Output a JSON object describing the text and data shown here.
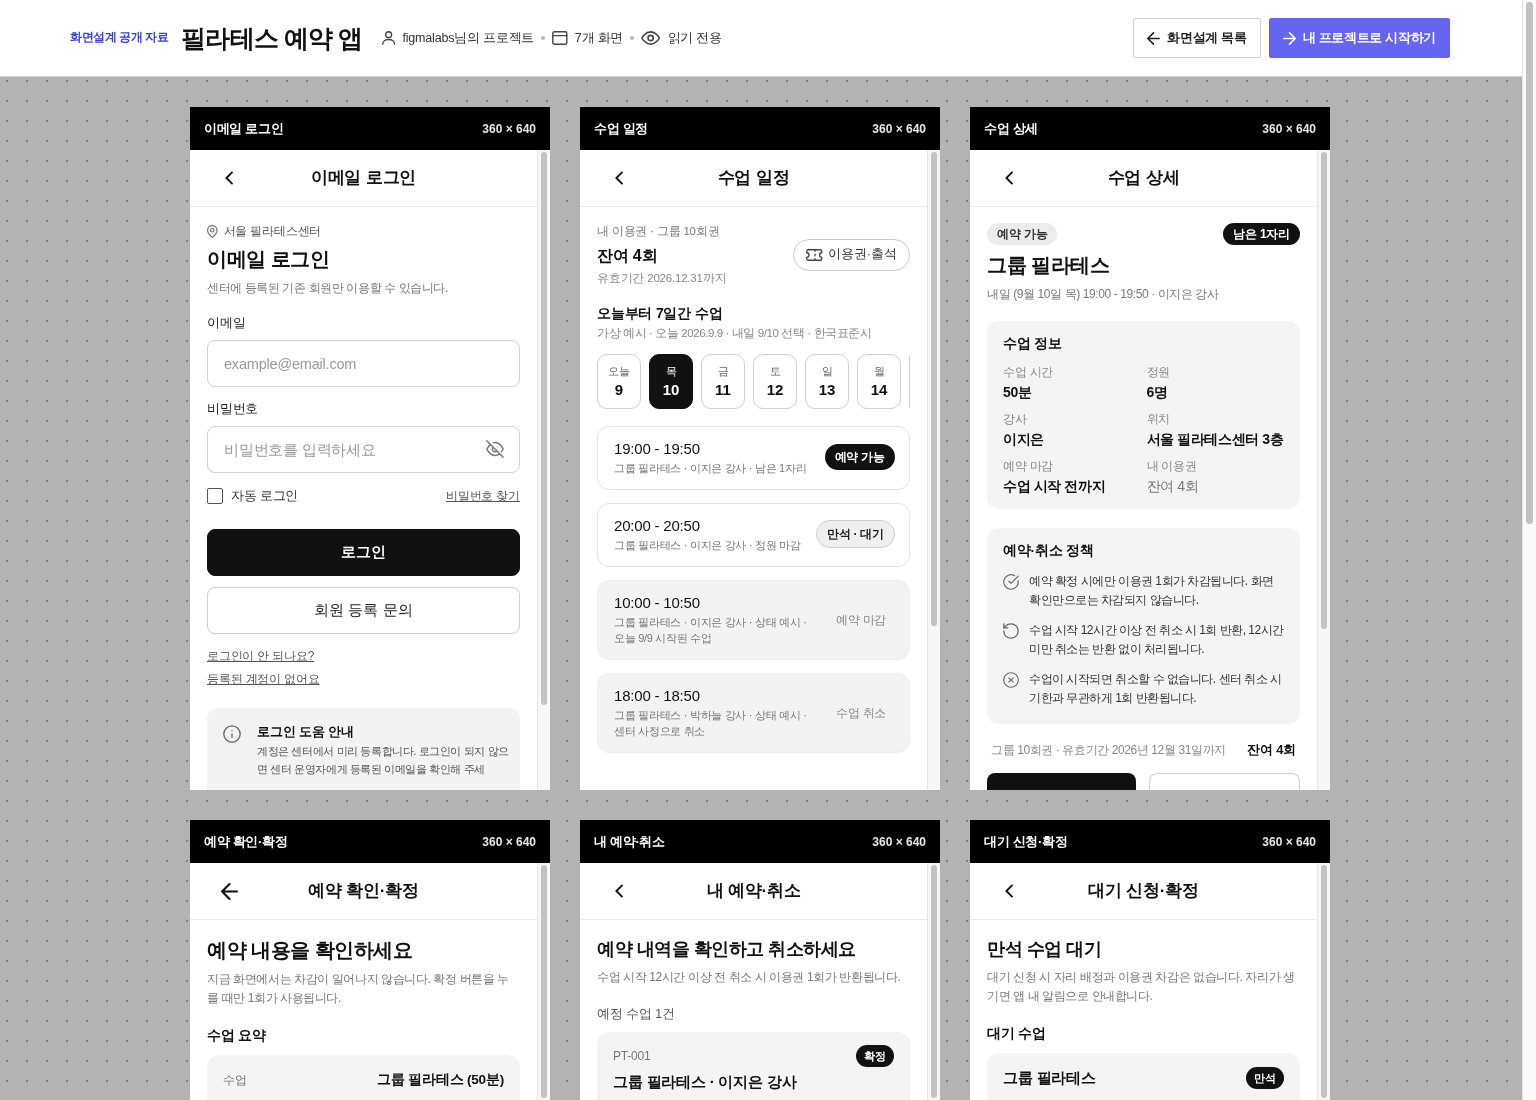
{
  "header": {
    "eyebrow": "화면설계 공개 자료",
    "title": "필라테스 예약 앱",
    "meta": [
      {
        "kind": "owner",
        "text": "figmalabs님의 프로젝트"
      },
      {
        "kind": "screens",
        "text": "7개 화면"
      },
      {
        "kind": "access",
        "text": "읽기 전용"
      }
    ],
    "buttons": [
      {
        "kind": "back",
        "label": "화면설계 목록"
      },
      {
        "kind": "start",
        "label": "내 프로젝트로 시작하기"
      }
    ]
  },
  "screens": [
    {
      "frame_title": "이메일 로그인",
      "size": "360 × 640",
      "back_button": {
        "kind": "chevron"
      },
      "title": "이메일 로그인",
      "blocks": [
        {
          "kind": "location",
          "text": "서울 필라테스센터"
        },
        {
          "kind": "heading",
          "text": "이메일 로그인"
        },
        {
          "kind": "subtitle",
          "text": "센터에 등록된 기존 회원만 이용할 수 있습니다."
        },
        {
          "kind": "email_field",
          "label": "이메일",
          "placeholder": "example@email.com"
        },
        {
          "kind": "password_field",
          "label": "비밀번호",
          "placeholder": "비밀번호를 입력하세요"
        },
        {
          "kind": "remember_row",
          "label": "자동 로그인",
          "checked": false,
          "link": "비밀번호 찾기"
        },
        {
          "kind": "primary_button",
          "label": "로그인"
        },
        {
          "kind": "outline_button",
          "label": "회원 등록 문의"
        },
        {
          "kind": "links",
          "items": [
            "로그인이 안 되나요?",
            "등록된 계정이 없어요"
          ]
        },
        {
          "kind": "help",
          "title": "로그인 도움 안내",
          "text": "계정은 센터에서 미리 등록합니다. 로그인이 되지 않으면 센터 운영자에게 등록된 이메일을 확인해 주세"
        }
      ]
    },
    {
      "frame_title": "수업 일정",
      "size": "360 × 640",
      "back_button": {
        "kind": "chevron"
      },
      "title": "수업 일정",
      "blocks": [
        {
          "kind": "pass_header",
          "label": "내 이용권 · 그룹 10회권",
          "remaining": "잔여 **4**회",
          "validity": "유효기간 2026.12.31까지",
          "button": "이용권·출석"
        },
        {
          "kind": "section",
          "title": "오늘부터 7일간 수업",
          "note": "가상 예시 · 오늘 2026.9.9 · 내일 9/10 선택 · 한국표준시",
          "muted": false
        },
        {
          "kind": "date_row",
          "dates": [
            {
              "day": "오늘",
              "date": "9",
              "selected": false
            },
            {
              "day": "목",
              "date": "10",
              "selected": true
            },
            {
              "day": "금",
              "date": "11",
              "selected": false
            },
            {
              "day": "토",
              "date": "12",
              "selected": false
            },
            {
              "day": "일",
              "date": "13",
              "selected": false
            },
            {
              "day": "월",
              "date": "14",
              "selected": false
            }
          ]
        },
        {
          "kind": "class_card",
          "time": "19:00 - 19:50",
          "meta": "그룹 필라테스 · 이지은 강사 · 남은 1자리",
          "status": {
            "kind": "available",
            "label": "예약 가능"
          }
        },
        {
          "kind": "class_card",
          "time": "20:00 - 20:50",
          "meta": "그룹 필라테스 · 이지은 강사 · 정원 마감",
          "status": {
            "kind": "waitlist",
            "label": "만석 · 대기"
          }
        },
        {
          "kind": "class_card",
          "time": "10:00 - 10:50",
          "meta": "그룹 필라테스 · 이지은 강사 · 상태 예시 · 오늘 9/9 시작된 수업",
          "status": {
            "kind": "closed",
            "label": "예약 마감"
          }
        },
        {
          "kind": "class_card",
          "time": "18:00 - 18:50",
          "meta": "그룹 필라테스 · 박하늘 강사 · 상태 예시 · 센터 사정으로 취소",
          "status": {
            "kind": "cancelled",
            "label": "수업 취소"
          }
        }
      ]
    },
    {
      "frame_title": "수업 상세",
      "size": "360 × 640",
      "back_button": {
        "kind": "chevron"
      },
      "title": "수업 상세",
      "blocks": [
        {
          "kind": "badge_row",
          "badges": [
            {
              "kind": "status",
              "text": "예약 가능"
            },
            {
              "kind": "seats",
              "text": "남은 1자리"
            }
          ]
        },
        {
          "kind": "heading",
          "text": "그룹 필라테스"
        },
        {
          "kind": "subtitle",
          "text": "내일 (9월 10일 목) 19:00 - 19:50 · 이지은 강사"
        },
        {
          "kind": "info_card",
          "title": "수업 정보",
          "items": [
            {
              "label": "수업 시간",
              "value": "50분",
              "muted": false
            },
            {
              "label": "정원",
              "value": "6명",
              "muted": false
            },
            {
              "label": "강사",
              "value": "이지은",
              "muted": false
            },
            {
              "label": "위치",
              "value": "서울 필라테스센터 3층",
              "muted": false
            },
            {
              "label": "예약 마감",
              "value": "수업 시작 전까지",
              "muted": false
            },
            {
              "label": "내 이용권",
              "value": "잔여 4회",
              "muted": true
            }
          ]
        },
        {
          "kind": "policy_card",
          "title": "예약·취소 정책",
          "items": [
            {
              "kind": "check",
              "text": "예약 확정 시에만 이용권 1회가 차감됩니다. 화면 확인만으로는 차감되지 않습니다."
            },
            {
              "kind": "refund",
              "text": "수업 시작 12시간 이상 전 취소 시 1회 반환, 12시간 미만 취소는 반환 없이 처리됩니다."
            },
            {
              "kind": "cancel",
              "text": "수업이 시작되면 취소할 수 없습니다. 센터 취소 시 기한과 무관하게 1회 반환됩니다."
            }
          ]
        },
        {
          "kind": "pass_footer",
          "text": "그룹 10회권 · 유효기간 2026년 12월 31일까지",
          "value": "잔여 4회"
        },
        {
          "kind": "action_row",
          "buttons": [
            {
              "kind": "primary"
            },
            {
              "kind": "secondary"
            }
          ]
        }
      ]
    },
    {
      "frame_title": "예약 확인·확정",
      "size": "360 × 640",
      "back_button": {
        "kind": "arrow"
      },
      "title": "예약 확인·확정",
      "blocks": [
        {
          "kind": "heading",
          "text": "예약 내용을 확인하세요"
        },
        {
          "kind": "subtitle",
          "text": "지금 화면에서는 차감이 일어나지 않습니다. 확정 버튼을 누를 때만 1회가 사용됩니다."
        },
        {
          "kind": "section",
          "title": "수업 요약",
          "muted": false
        },
        {
          "kind": "summary_card",
          "rows": [
            {
              "label": "수업",
              "value": "그룹 필라테스 (50분)"
            }
          ]
        }
      ]
    },
    {
      "frame_title": "내 예약·취소",
      "size": "360 × 640",
      "back_button": {
        "kind": "chevron"
      },
      "title": "내 예약·취소",
      "blocks": [
        {
          "kind": "heading_compact",
          "text": "예약 내역을 확인하고 취소하세요"
        },
        {
          "kind": "subtitle",
          "text": "수업 시작 12시간 이상 전 취소 시 이용권 1회가 반환됩니다."
        },
        {
          "kind": "section",
          "title": "예정 수업 1건",
          "muted": true
        },
        {
          "kind": "booking_card",
          "code": "PT-001",
          "badge": "확정",
          "title": "그룹 필라테스 · 이지은 강사"
        }
      ]
    },
    {
      "frame_title": "대기 신청·확정",
      "size": "360 × 640",
      "back_button": {
        "kind": "chevron"
      },
      "title": "대기 신청·확정",
      "blocks": [
        {
          "kind": "heading_compact",
          "text": "만석 수업 대기"
        },
        {
          "kind": "subtitle",
          "text": "대기 신청 시 자리 배정과 이용권 차감은 없습니다. 자리가 생기면 앱 내 알림으로 안내합니다."
        },
        {
          "kind": "section",
          "title": "대기 수업",
          "muted": false
        },
        {
          "kind": "waitlist_card",
          "title": "그룹 필라테스",
          "badge": "만석"
        }
      ]
    }
  ]
}
